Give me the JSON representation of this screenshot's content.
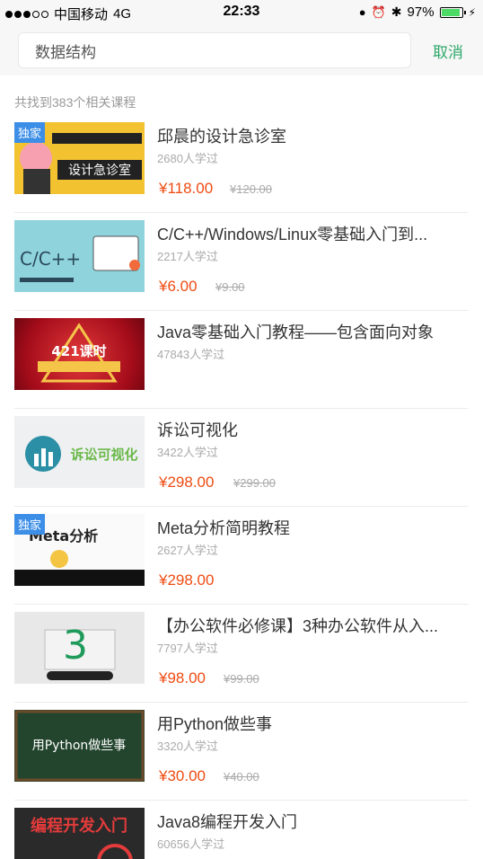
{
  "status_bar": {
    "carrier": "中国移动",
    "network": "4G",
    "time": "22:33",
    "battery": "97%"
  },
  "search": {
    "value": "数据结构",
    "cancel_label": "取消"
  },
  "result_count": "共找到383个相关课程",
  "courses": [
    {
      "title": "邱晨的设计急诊室",
      "students": "2680人学过",
      "price": "¥118.00",
      "original_price": "¥120.00",
      "badge": "独家",
      "thumb_text": "设计急诊室"
    },
    {
      "title": "C/C++/Windows/Linux零基础入门到...",
      "students": "2217人学过",
      "price": "¥6.00",
      "original_price": "¥9.00",
      "badge": "",
      "thumb_text": "C/C++"
    },
    {
      "title": "Java零基础入门教程——包含面向对象",
      "students": "47843人学过",
      "price": "",
      "original_price": "",
      "badge": "",
      "thumb_text": "421课时"
    },
    {
      "title": "诉讼可视化",
      "students": "3422人学过",
      "price": "¥298.00",
      "original_price": "¥299.00",
      "badge": "",
      "thumb_text": "诉讼可视化"
    },
    {
      "title": "Meta分析简明教程",
      "students": "2627人学过",
      "price": "¥298.00",
      "original_price": "",
      "badge": "独家",
      "thumb_text": "Meta分析"
    },
    {
      "title": "【办公软件必修课】3种办公软件从入...",
      "students": "7797人学过",
      "price": "¥98.00",
      "original_price": "¥99.00",
      "badge": "",
      "thumb_text": "3"
    },
    {
      "title": "用Python做些事",
      "students": "3320人学过",
      "price": "¥30.00",
      "original_price": "¥40.00",
      "badge": "",
      "thumb_text": "用Python做些事"
    },
    {
      "title": "Java8编程开发入门",
      "students": "60656人学过",
      "price": "",
      "original_price": "",
      "badge": "",
      "thumb_text": "编程开发入门"
    }
  ]
}
